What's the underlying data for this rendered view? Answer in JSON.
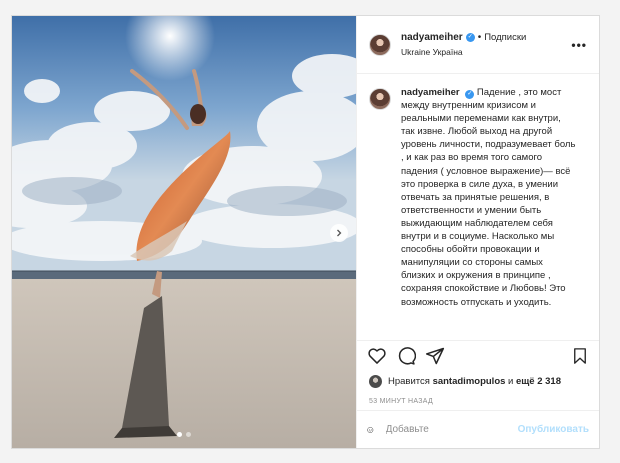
{
  "post": {
    "username": "nadyameiher",
    "follow_separator": "•",
    "follow_label": "Подписки",
    "location": "Ukraine Україна",
    "more_label": "•••",
    "caption": "Падение , это мост между внутренним кризисом и реальными переменами как внутри, так извне. Любой выход на другой уровень личности, подразумевает боль , и как раз во время того самого падения ( условное выражение)— всё это проверка в силе духа, в умении отвечать за принятые решения, в ответственности и умении быть выжидающим наблюдателем себя внутри и в социуме. Насколько мы способны обойти провокации и манипуляции со стороны самых близких и окружения в принципе , сохраняя спокойствие и Любовь! Это возможность отпускать и уходить.",
    "likes": {
      "prefix": "Нравится",
      "liker": "santadimopulos",
      "middle": "и",
      "others": "ещё 2 318"
    },
    "time": "53 МИНУТ НАЗАД",
    "comment_placeholder": "Добавьте",
    "publish_label": "Опубликовать"
  },
  "carousel": {
    "current_slide": 1,
    "total_slides": 2
  },
  "icons": {
    "like": "heart-icon",
    "comment": "comment-icon",
    "share": "share-icon",
    "save": "bookmark-icon",
    "emoji": "emoji-icon",
    "next": "chevron-right-icon",
    "verified": "verified-badge-icon"
  },
  "colors": {
    "verified": "#3897f0",
    "publish_disabled": "#b2dffc",
    "muted_text": "#8e8e8e"
  }
}
